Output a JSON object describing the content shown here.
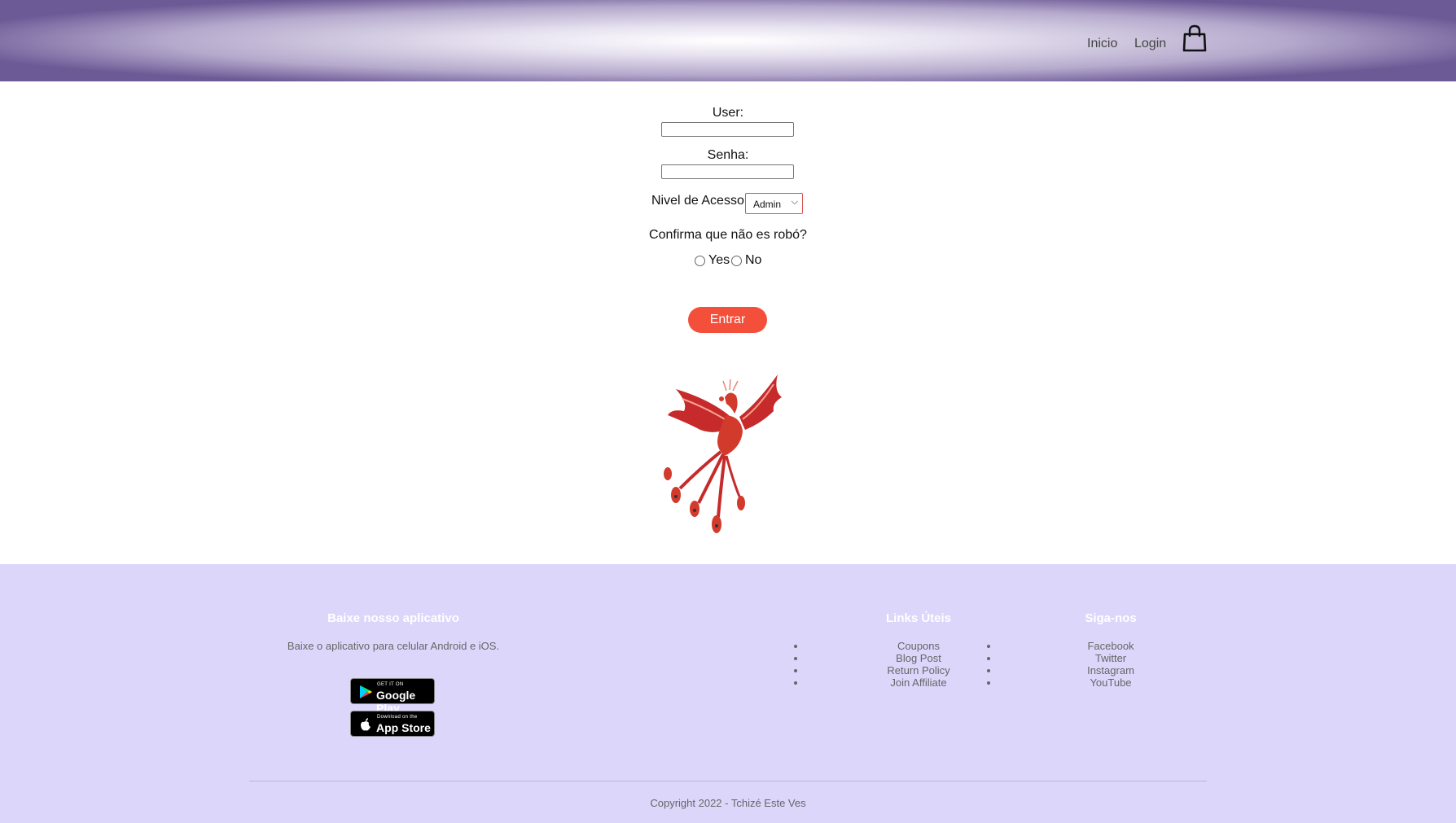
{
  "nav": {
    "home": "Inicio",
    "login": "Login",
    "cart_icon": "shopping-bag-icon"
  },
  "form": {
    "user_label": "User:",
    "password_label": "Senha:",
    "access_level_label": "Nivel de Acesso:",
    "access_level_value": "Admin",
    "robot_question": "Confirma que não es robó?",
    "radio_yes": "Yes",
    "radio_no": "No",
    "submit_label": "Entrar"
  },
  "footer": {
    "app_heading": "Baixe nosso aplicativo",
    "app_text": "Baixe o aplicativo para celular Android e iOS.",
    "google_play": {
      "small": "GET IT ON",
      "big": "Google Play"
    },
    "app_store": {
      "small": "Download on the",
      "big": "App Store"
    },
    "links_heading": "Links Úteis",
    "links": [
      "Coupons",
      "Blog Post",
      "Return Policy",
      "Join Affiliate"
    ],
    "social_heading": "Siga-nos",
    "social": [
      "Facebook",
      "Twitter",
      "Instagram",
      "YouTube"
    ],
    "copyright": "Copyright 2022 - Tchizé Este Ves"
  },
  "colors": {
    "accent": "#f44f3a",
    "footer_bg": "#dcd6fb",
    "header_edge": "#6c5a96"
  }
}
